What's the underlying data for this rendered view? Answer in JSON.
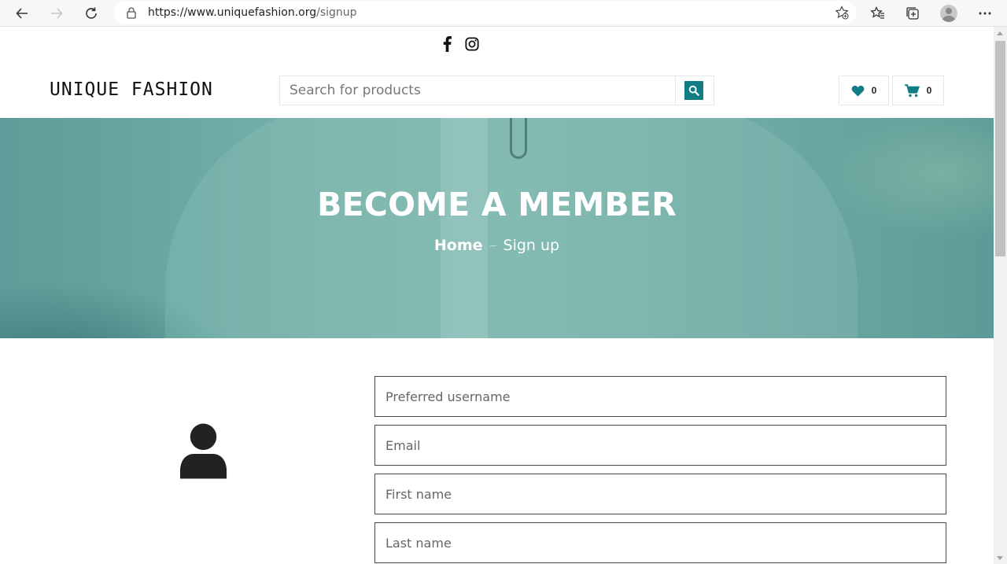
{
  "browser": {
    "url_host": "https://www.uniquefashion.org",
    "url_path": "/signup",
    "icons": [
      "back-arrow-icon",
      "forward-arrow-icon",
      "reload-icon",
      "lock-icon",
      "add-favorite-icon",
      "favorites-icon",
      "collections-icon",
      "profile-icon",
      "more-icon"
    ]
  },
  "social": {
    "icons": [
      "facebook-icon",
      "instagram-icon"
    ]
  },
  "header": {
    "logo": "UNIQUE FASHION",
    "search_placeholder": "Search for products",
    "wishlist_count": "0",
    "cart_count": "0"
  },
  "hero": {
    "title": "BECOME A MEMBER",
    "breadcrumb_home": "Home",
    "breadcrumb_current": "Sign up"
  },
  "form": {
    "username_placeholder": "Preferred username",
    "email_placeholder": "Email",
    "first_name_placeholder": "First name",
    "last_name_placeholder": "Last name"
  },
  "colors": {
    "accent": "#0f7d83",
    "hero_tint": "#6aa8a3",
    "field_border": "#4a4a4a"
  }
}
